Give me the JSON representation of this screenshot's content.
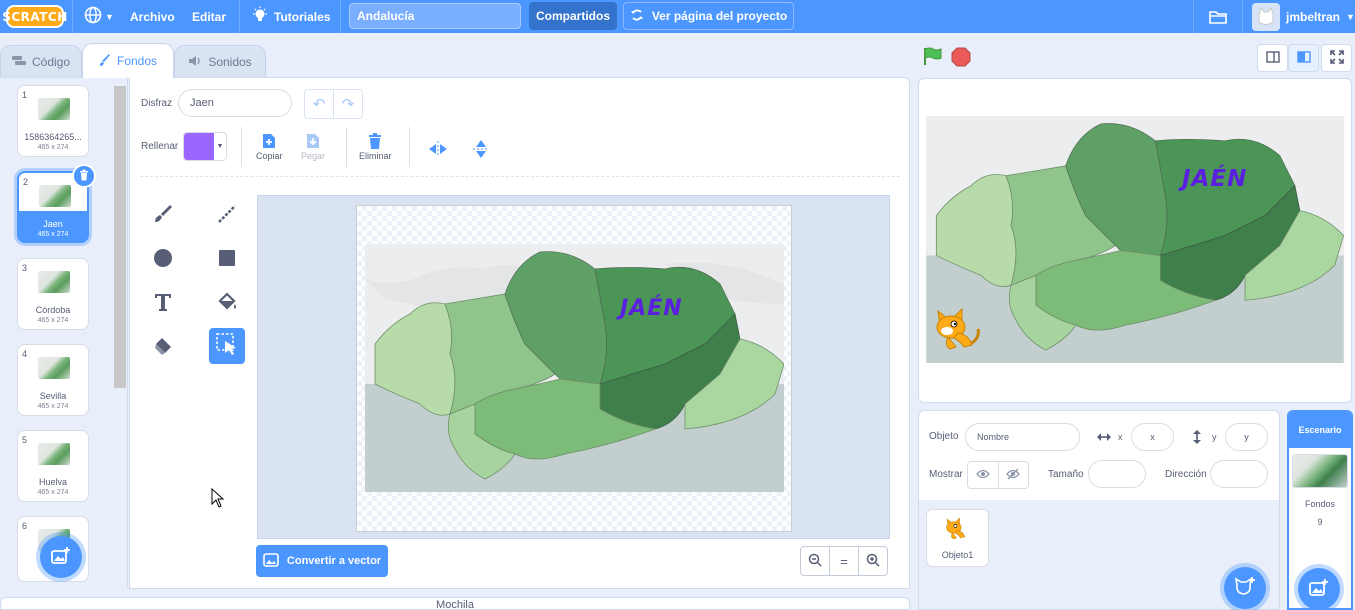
{
  "menubar": {
    "logo": "SCRATCH",
    "file": "Archivo",
    "edit": "Editar",
    "tutorials": "Tutoriales",
    "project_title": "Andalucía",
    "shared": "Compartidos",
    "see_project_page": "Ver página del proyecto",
    "username": "jmbeltran"
  },
  "tabs": {
    "code": "Código",
    "backdrops": "Fondos",
    "sounds": "Sonidos"
  },
  "costumes": [
    {
      "num": "1",
      "name": "1586364265...",
      "size": "465 x 274"
    },
    {
      "num": "2",
      "name": "Jaen",
      "size": "465 x 274"
    },
    {
      "num": "3",
      "name": "Córdoba",
      "size": "465 x 274"
    },
    {
      "num": "4",
      "name": "Sevilla",
      "size": "465 x 274"
    },
    {
      "num": "5",
      "name": "Huelva",
      "size": "465 x 274"
    },
    {
      "num": "6",
      "name": "",
      "size": ""
    }
  ],
  "editor": {
    "costume_label": "Disfraz",
    "costume_name": "Jaen",
    "fill_label": "Rellenar",
    "fill_color": "#9966ff",
    "copy": "Copiar",
    "paste": "Pegar",
    "delete": "Eliminar",
    "map_text": "JAÉN",
    "convert_vector": "Convertir a vector",
    "zoom_reset": "="
  },
  "backpack": "Mochila",
  "sprite_info": {
    "sprite_label": "Objeto",
    "name_placeholder": "Nombre",
    "x_label": "x",
    "y_label": "y",
    "x_placeholder": "x",
    "y_placeholder": "y",
    "show_label": "Mostrar",
    "size_label": "Tamaño",
    "direction_label": "Dirección"
  },
  "sprites": [
    {
      "name": "Objeto1"
    }
  ],
  "stage_panel": {
    "title": "Escenario",
    "backdrops_label": "Fondos",
    "backdrops_count": "9"
  },
  "colors": {
    "accent": "#4c97ff",
    "menubar": "#4c97ff",
    "selected_tab_text": "#4c97ff",
    "map_jaen": "#3f8a52",
    "jaen_text": "#5b1fe0"
  }
}
